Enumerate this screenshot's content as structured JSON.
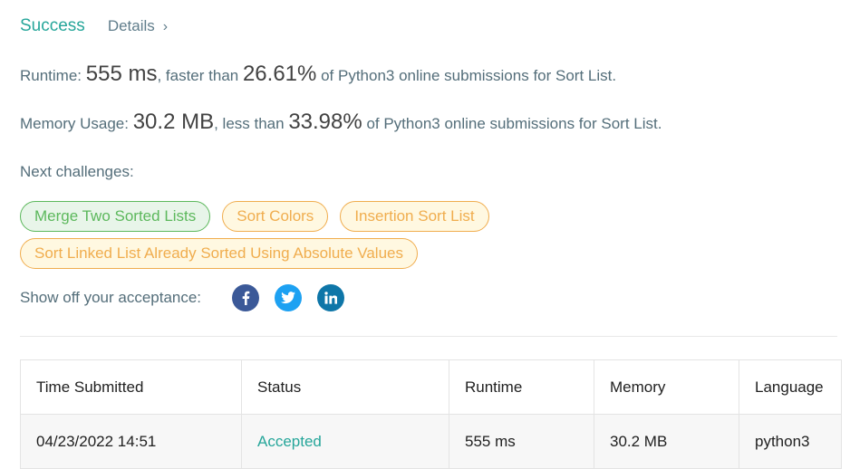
{
  "header": {
    "status": "Success",
    "details_label": "Details",
    "details_chevron": "›"
  },
  "runtime": {
    "label": "Runtime: ",
    "value": "555 ms",
    "comparison": ", faster than ",
    "percent": "26.61%",
    "suffix": " of Python3 online submissions for Sort List."
  },
  "memory": {
    "label": "Memory Usage: ",
    "value": "30.2 MB",
    "comparison": ", less than ",
    "percent": "33.98%",
    "suffix": " of Python3 online submissions for Sort List."
  },
  "next_challenges": {
    "label": "Next challenges:",
    "items": [
      {
        "label": "Merge Two Sorted Lists",
        "difficulty": "easy",
        "color": "#5cb85c"
      },
      {
        "label": "Sort Colors",
        "difficulty": "medium",
        "color": "#f0ad4e"
      },
      {
        "label": "Insertion Sort List",
        "difficulty": "medium",
        "color": "#f0ad4e"
      },
      {
        "label": "Sort Linked List Already Sorted Using Absolute Values",
        "difficulty": "medium",
        "color": "#f0ad4e"
      }
    ]
  },
  "share": {
    "label": "Show off your acceptance:",
    "icons": [
      "facebook-icon",
      "twitter-icon",
      "linkedin-icon"
    ]
  },
  "submissions": {
    "columns": [
      "Time Submitted",
      "Status",
      "Runtime",
      "Memory",
      "Language"
    ],
    "rows": [
      {
        "time": "04/23/2022 14:51",
        "status": "Accepted",
        "runtime": "555 ms",
        "memory": "30.2 MB",
        "language": "python3"
      }
    ]
  },
  "colors": {
    "accent": "#26a69a",
    "easy": "#5cb85c",
    "medium": "#f0ad4e"
  }
}
